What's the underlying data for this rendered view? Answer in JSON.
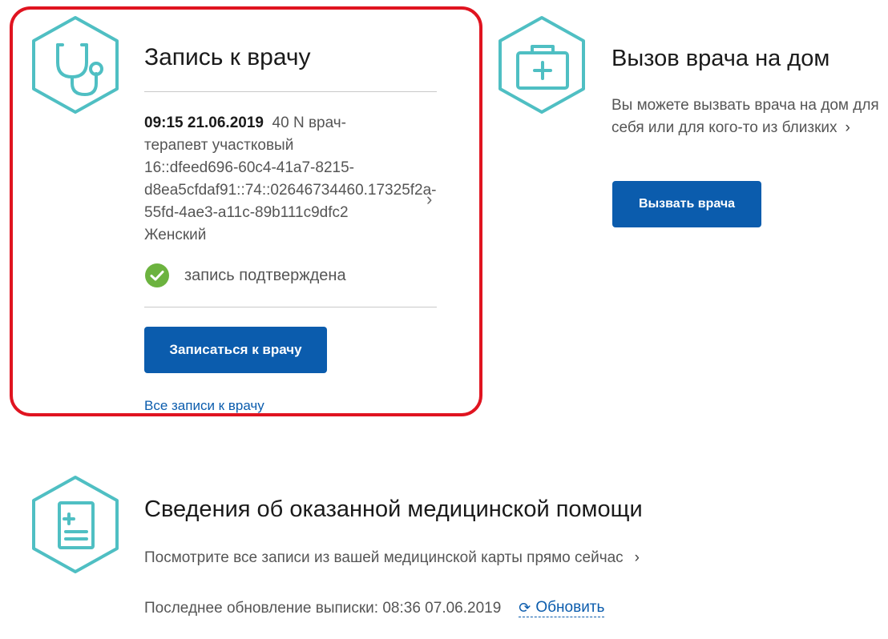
{
  "colors": {
    "accent": "#0b5cad",
    "icon_teal": "#4fbfc3",
    "highlight_red": "#e01420",
    "success_green": "#6cb33f"
  },
  "appointment_card": {
    "icon": "stethoscope-icon",
    "title": "Запись к врачу",
    "appointment": {
      "datetime": "09:15 21.06.2019",
      "details_line1": "40 N врач-",
      "details_line2": "терапевт участковый",
      "details_line3": "16::dfeed696-60c4-41a7-8215-",
      "details_line4": "d8ea5cfdaf91::74::02646734460.17325f2a-",
      "details_line5": "55fd-4ae3-a11c-89b111c9dfc2",
      "details_line6": "Женский"
    },
    "status_icon": "checkmark-circle-icon",
    "status_text": "запись подтверждена",
    "button_label": "Записаться к врачу",
    "all_link": "Все записи к врачу"
  },
  "home_visit_card": {
    "icon": "medical-kit-icon",
    "title": "Вызов врача на дом",
    "description": "Вы можете вызвать врача на дом для себя или для кого-то из близких",
    "chevron": "›",
    "button_label": "Вызвать врача"
  },
  "records_card": {
    "icon": "medical-document-icon",
    "title": "Сведения об оказанной медицинской помощи",
    "description": "Посмотрите все записи из вашей медицинской карты прямо сейчас",
    "chevron": "›",
    "update_text": "Последнее обновление выписки: 08:36 07.06.2019",
    "refresh_label": "Обновить",
    "refresh_icon": "refresh-icon"
  }
}
